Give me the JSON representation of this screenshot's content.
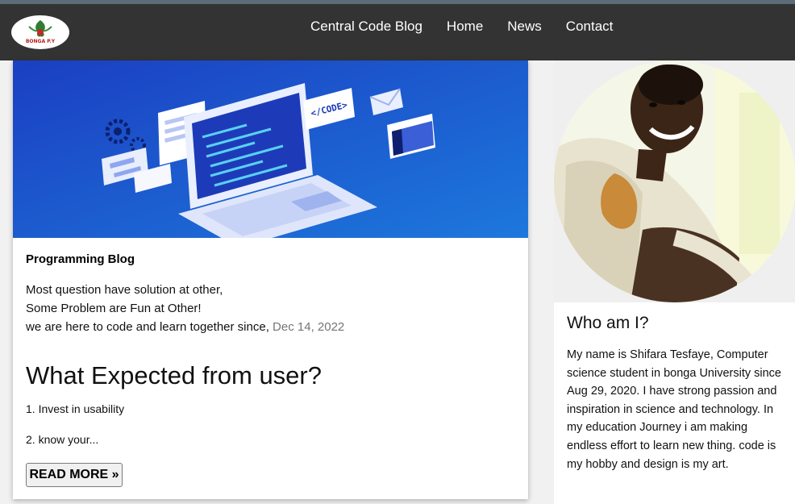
{
  "nav": {
    "logo_text": "BONGA P.Y",
    "links": [
      "Central Code Blog",
      "Home",
      "News",
      "Contact"
    ]
  },
  "post": {
    "hero_code_label": "</CODE>",
    "blog_title": "Programming Blog",
    "intro_line1": "Most question have solution at other,",
    "intro_line2": "Some Problem are Fun at Other!",
    "intro_line3": "we are here to code and learn together since,",
    "date": "Dec 14, 2022",
    "heading": "What Expected from user?",
    "item1": "1. Invest in usability",
    "item2": "2. know your...",
    "read_more": "READ MORE »"
  },
  "sidebar": {
    "title": "Who am I?",
    "bio": "My name is Shifara Tesfaye, Computer science student in bonga University since Aug 29, 2020. I have strong passion and inspiration in science and technology. In my education Journey i am making endless effort to learn new thing. code is my hobby and design is my art."
  },
  "colors": {
    "navbar": "#333333",
    "hero_blue": "#1f4fd0",
    "date_gray": "#757575"
  }
}
